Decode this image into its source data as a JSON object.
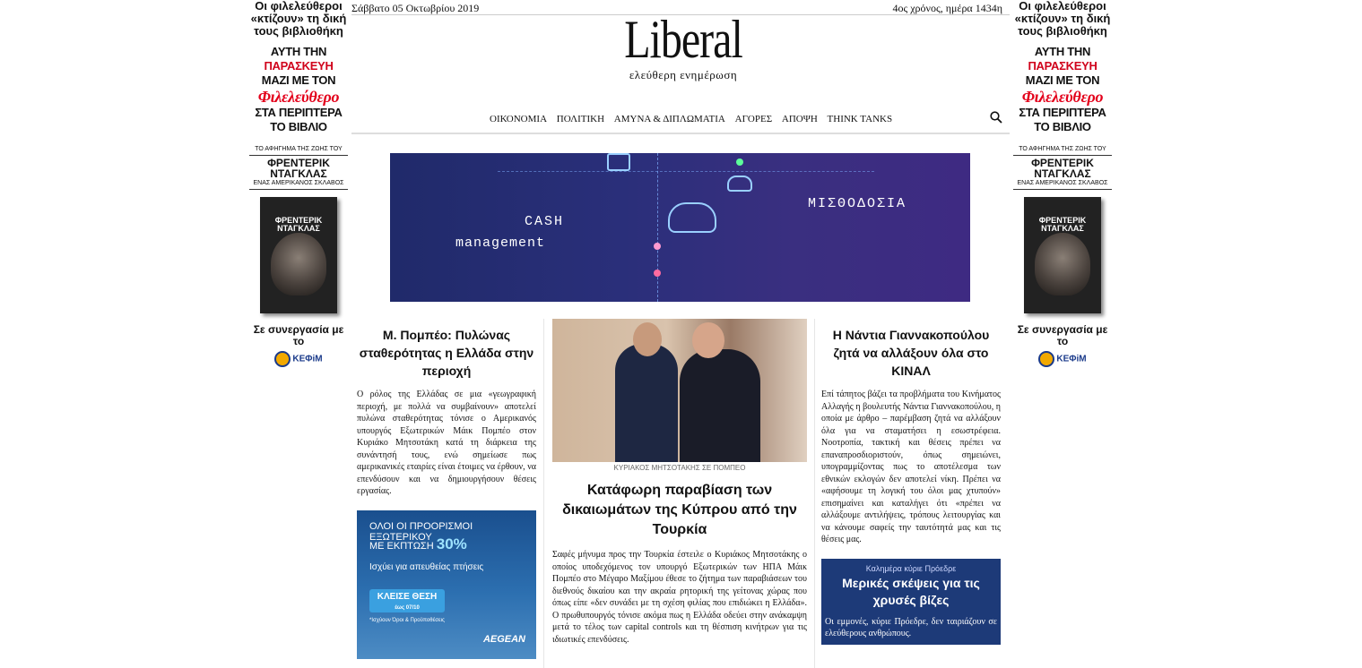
{
  "skin": {
    "line1": "Οι φιλελεύθεροι «κτίζουν» τη δική τους βιβλιοθήκη",
    "l2a": "ΑΥΤΗ ΤΗΝ",
    "l2b": "ΠΑΡΑΣΚΕΥΗ",
    "l2c": "ΜΑΖΙ ΜΕ ΤΟΝ",
    "brand": "Φιλελεύθερο",
    "l2d": "ΣΤΑ ΠΕΡΙΠΤΕΡΑ",
    "l2e": "ΤΟ ΒΙΒΛΙΟ",
    "book_small": "ΤΟ ΑΦΗΓΗΜΑ ΤΗΣ ΖΩΗΣ ΤΟΥ",
    "book_title": "ΦΡΕΝΤΕΡΙΚ ΝΤΑΓΚΛΑΣ",
    "book_sub": "ΕΝΑΣ ΑΜΕΡΙΚΑΝΟΣ ΣΚΛΑΒΟΣ",
    "collab": "Σε συνεργασία με το",
    "kefim": "ΚΕΦiΜ"
  },
  "header": {
    "date": "Σάββατο 05 Οκτωβρίου 2019",
    "year_day": "4ος χρόνος, ημέρα 1434η",
    "logo": "Liberal",
    "tagline": "ελεύθερη ενημέρωση"
  },
  "nav": [
    "ΟΙΚΟΝΟΜΙΑ",
    "ΠΟΛΙΤΙΚΗ",
    "ΑΜΥΝΑ & ΔΙΠΛΩΜΑΤΙΑ",
    "ΑΓΟΡΕΣ",
    "ΑΠΟΨΗ",
    "THINK TANKS"
  ],
  "banner": {
    "cash": "CASH",
    "management": "management",
    "payroll": "ΜΙΣΘΟΔΟΣΙΑ"
  },
  "left_article": {
    "title": "Μ. Πομπέο: Πυλώνας σταθερότητας η Ελλάδα στην περιοχή",
    "body": "Ο ρόλος της Ελλάδας σε μια «γεωγραφική περιοχή, με πολλά να συμβαίνουν» αποτελεί πυλώνα σταθερότητας τόνισε ο Αμερικανός υπουργός Εξωτερικών Μάικ Πομπέο στον Κυριάκο Μητσοτάκη κατά τη διάρκεια της συνάντησή τους, ενώ σημείωσε πως αμερικανικές εταιρίες είναι έτοιμες να έρθουν, να επενδύσουν και να δημιουργήσουν θέσεις εργασίας."
  },
  "aegean_ad": {
    "line1": "ΟΛΟΙ ΟΙ ΠΡΟΟΡΙΣΜΟΙ ΕΞΩΤΕΡΙΚΟΥ",
    "line2": "ΜΕ ΕΚΠΤΩΣΗ",
    "pct": "30%",
    "line3": "Ισχύει για απευθείας πτήσεις",
    "btn": "ΚΛΕΙΣΕ ΘΕΣΗ",
    "btn_small": "έως 07/10",
    "terms": "*Ισχύουν Όροι & Προϋποθέσεις",
    "brand": "AEGEAN"
  },
  "mid_article": {
    "caption": "ΚΥΡΙΑΚΟΣ ΜΗΤΣΟΤΑΚΗΣ ΣΕ ΠΟΜΠΕΟ",
    "title": "Κατάφωρη παραβίαση των δικαιωμάτων της Κύπρου από την Τουρκία",
    "body": "Σαφές μήνυμα προς την Τουρκία έστειλε ο Κυριάκος Μητσοτάκης ο οποίος υποδεχόμενος τον υπουργό Εξωτερικών των ΗΠΑ Μάικ Πομπέο στο Μέγαρο Μαξίμου έθεσε το ζήτημα των παραβιάσεων του διεθνούς δικαίου και την ακραία ρητορική της γείτονας χώρας που όπως είπε «δεν συνάδει με τη σχέση φιλίας που επιδιώκει η Ελλάδα». Ο πρωθυπουργός τόνισε ακόμα πως η Ελλάδα οδεύει στην ανάκαμψη μετά το τέλος των capital controls και τη θέσπιση κινήτρων για τις ιδιωτικές επενδύσεις."
  },
  "right_article": {
    "title": "Η Νάντια Γιαννακοπούλου ζητά να αλλάξουν όλα στο ΚΙΝΑΛ",
    "body": "Επί τάπητος βάζει τα προβλήματα του Κινήματος Αλλαγής η βουλευτής Νάντια Γιαννακοπούλου, η οποία με άρθρο – παρέμβαση ζητά να αλλάξουν όλα για να σταματήσει η εσωστρέφεια. Νοοτροπία, τακτική και θέσεις πρέπει να επαναπροσδιοριστούν, όπως σημειώνει, υπογραμμίζοντας πως το αποτέλεσμα των εθνικών εκλογών δεν αποτελεί νίκη. Πρέπει να «αφήσουμε τη λογική του όλοι μας χτυπούν» επισημαίνει και καταλήγει ότι «πρέπει να αλλάξουμε αντιλήψεις, τρόπους λειτουργίας και να κάνουμε σαφείς την ταυτότητά μας και τις θέσεις μας."
  },
  "right_box": {
    "kicker": "Καλημέρα κύριε Πρόεδρε",
    "title": "Μερικές σκέψεις για τις χρυσές βίζες",
    "body": "Οι εμμονές, κύριε Πρόεδρε, δεν ταιριάζουν σε ελεύθερους ανθρώπους."
  }
}
